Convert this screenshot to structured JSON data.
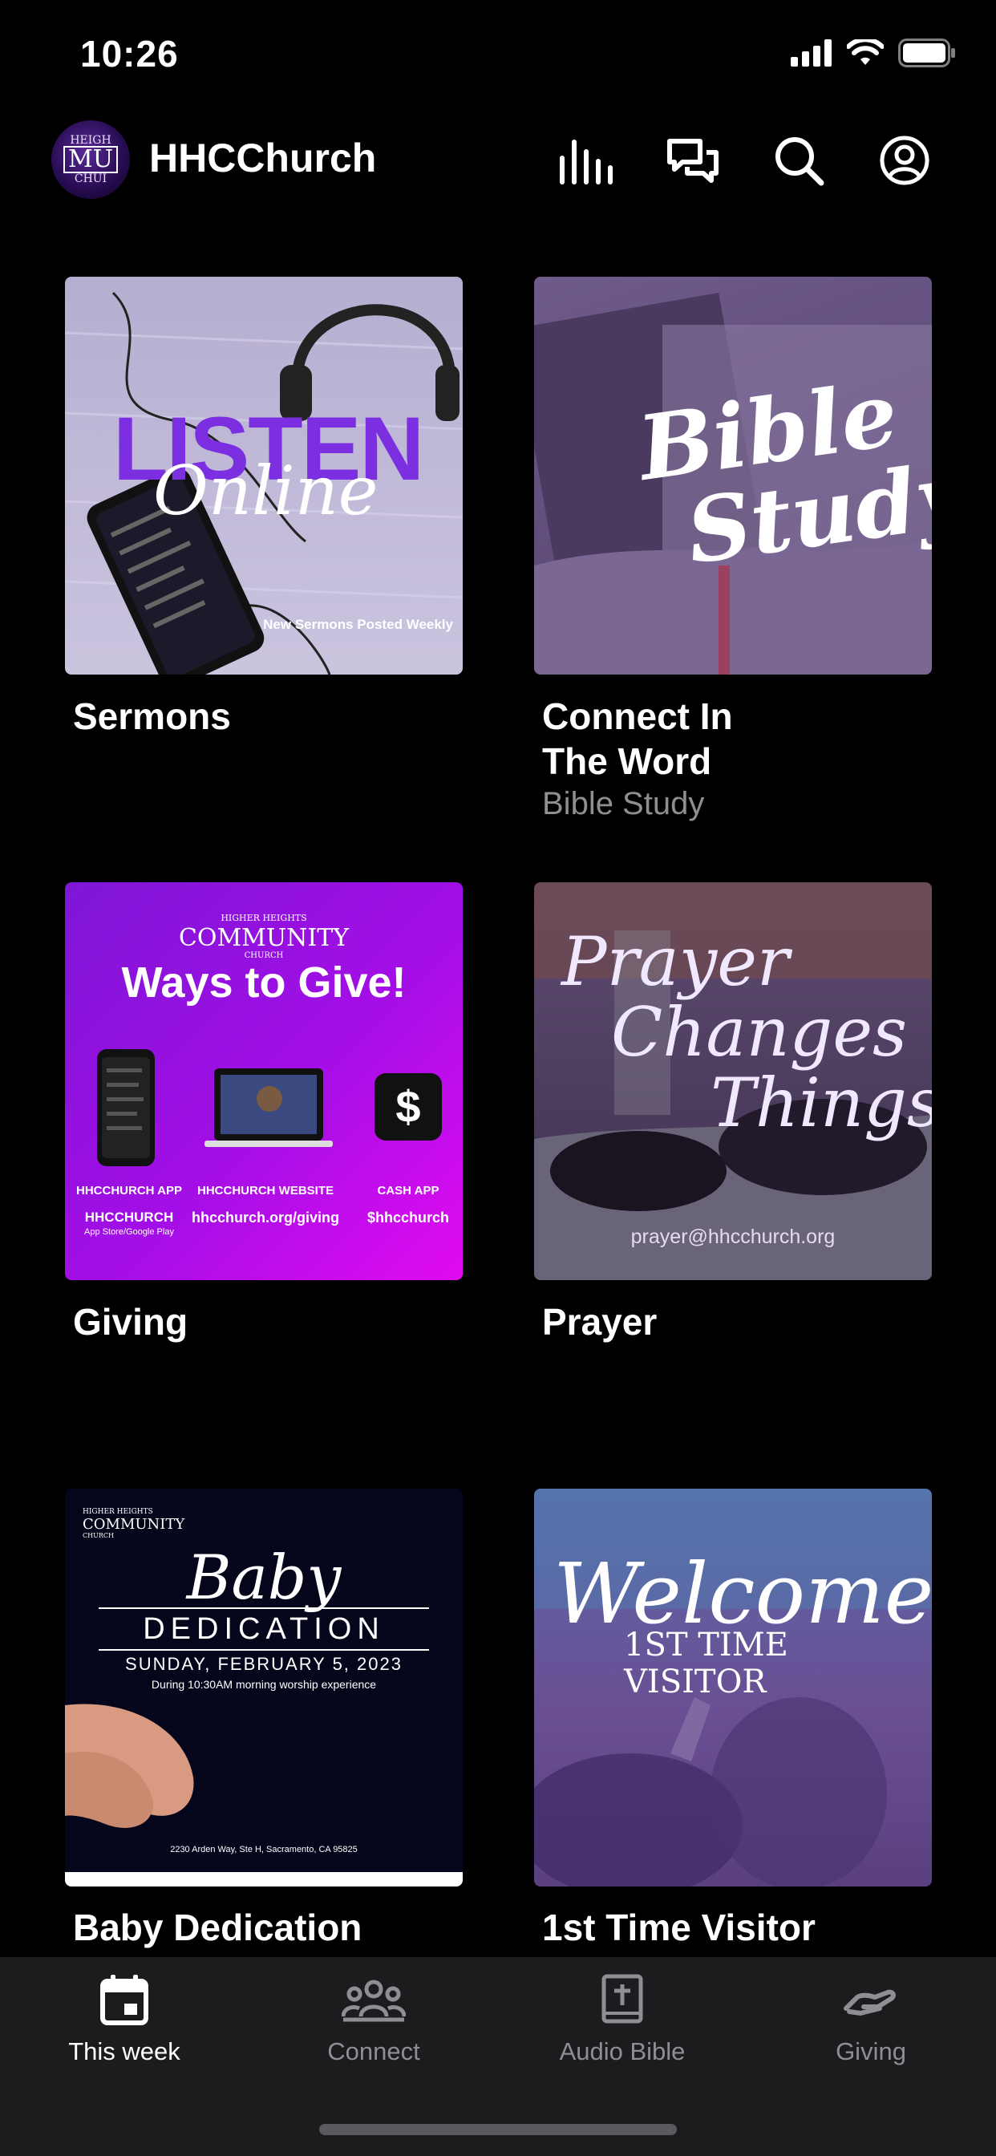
{
  "status_bar": {
    "time": "10:26"
  },
  "header": {
    "logo_text": {
      "top": "HEIGH",
      "middle": "MU",
      "bottom": "CHUI"
    },
    "title": "HHCChurch",
    "icons": [
      "equalizer-icon",
      "chat-icon",
      "search-icon",
      "profile-icon"
    ]
  },
  "tiles": [
    {
      "title": "Sermons",
      "subtitle": "",
      "art": {
        "headline": "LISTEN",
        "script": "Online",
        "caption": "New Sermons Posted Weekly"
      }
    },
    {
      "title": "Connect In The Word",
      "subtitle": "Bible Study",
      "art": {
        "line1": "Bible",
        "line2": "Study"
      }
    },
    {
      "title": "Giving",
      "subtitle": "",
      "art": {
        "brand_top": "HIGHER HEIGHTS",
        "brand": "COMMUNITY",
        "brand_bottom": "CHURCH",
        "headline": "Ways to Give!",
        "col1_label": "HHCCHURCH APP",
        "col1_value": "HHCCHURCH",
        "col1_note": "App Store/Google Play",
        "col2_label": "HHCCHURCH WEBSITE",
        "col2_value": "hhcchurch.org/giving",
        "col3_label": "CASH APP",
        "col3_value": "$hhcchurch",
        "cash_symbol": "$"
      }
    },
    {
      "title": "Prayer",
      "subtitle": "",
      "art": {
        "line1": "Prayer",
        "line2": "Changes",
        "line3": "Things",
        "email": "prayer@hhcchurch.org"
      }
    },
    {
      "title": "Baby Dedication",
      "subtitle": "",
      "art": {
        "brand_top": "HIGHER HEIGHTS",
        "brand": "COMMUNITY",
        "brand_bottom": "CHURCH",
        "script": "Baby",
        "headline": "DEDICATION",
        "date": "SUNDAY, FEBRUARY 5, 2023",
        "note": "During 10:30AM morning worship experience",
        "address": "2230 Arden Way, Ste H, Sacramento, CA 95825"
      }
    },
    {
      "title": "1st Time Visitor",
      "subtitle": "",
      "art": {
        "script": "Welcome",
        "line2": "1ST TIME VISITOR"
      }
    }
  ],
  "tabs": [
    {
      "label": "This week",
      "icon": "calendar-icon",
      "active": true
    },
    {
      "label": "Connect",
      "icon": "people-icon",
      "active": false
    },
    {
      "label": "Audio Bible",
      "icon": "bible-icon",
      "active": false
    },
    {
      "label": "Giving",
      "icon": "giving-hand-icon",
      "active": false
    }
  ],
  "colors": {
    "background": "#000000",
    "tabbar": "#1c1c1e",
    "inactive": "#8e8e93",
    "accent_purple": "#8b2be2"
  }
}
